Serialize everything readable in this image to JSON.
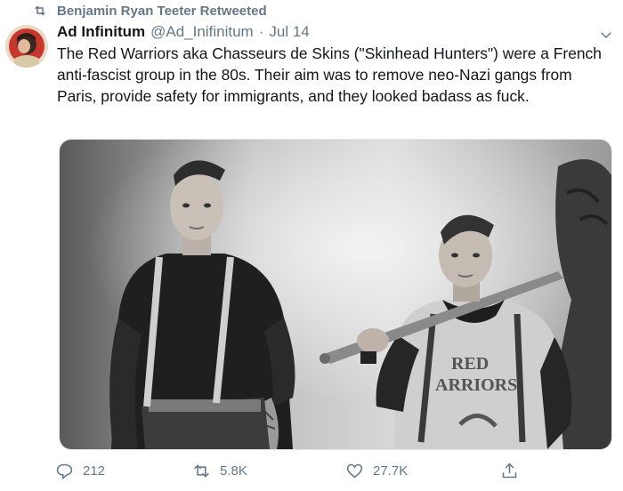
{
  "retweet": {
    "text": "Benjamin Ryan Teeter Retweeted"
  },
  "tweet": {
    "display_name": "Ad Infinitum",
    "handle": "@Ad_Inifinitum",
    "separator": "·",
    "date": "Jul 14",
    "text": "The Red Warriors aka Chasseurs de Skins (\"Skinhead Hunters\") were a French anti-fascist group in the 80s. Their aim was to remove neo-Nazi gangs from Paris, provide safety for immigrants, and they looked badass as fuck."
  },
  "media": {
    "shirt_text_line1": "RED",
    "shirt_text_line2": "ARRIORS"
  },
  "actions": {
    "replies": "212",
    "retweets": "5.8K",
    "likes": "27.7K"
  },
  "icons": {
    "retweet": "retweet-icon",
    "reply": "reply-icon",
    "like": "heart-icon",
    "share": "share-icon",
    "more": "chevron-down-icon"
  },
  "colors": {
    "secondary_text": "#657786",
    "primary_text": "#14171a"
  }
}
